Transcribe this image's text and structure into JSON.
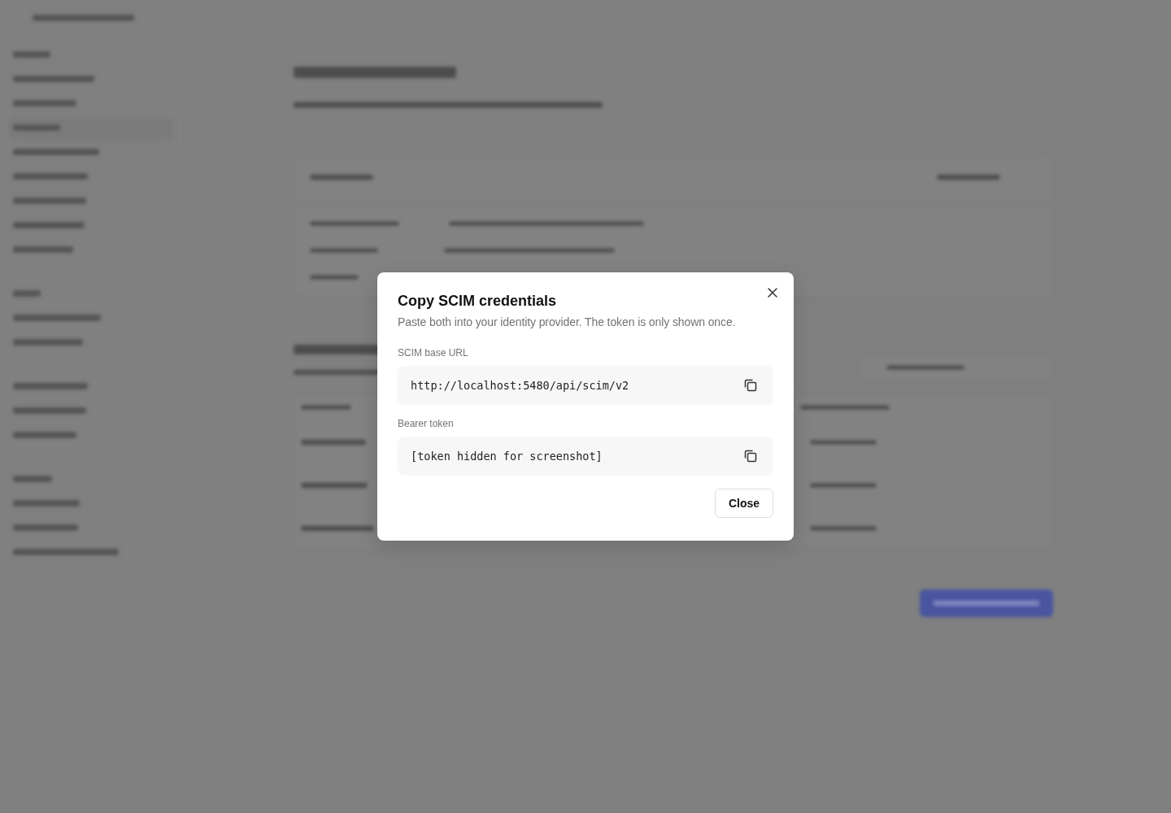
{
  "dialog": {
    "title": "Copy SCIM credentials",
    "description": "Paste both into your identity provider. The token is only shown once.",
    "fields": [
      {
        "label": "SCIM base URL",
        "value": "http://localhost:5480/api/scim/v2"
      },
      {
        "label": "Bearer token",
        "value": "[token hidden for screenshot]"
      }
    ],
    "close_button": "Close"
  }
}
